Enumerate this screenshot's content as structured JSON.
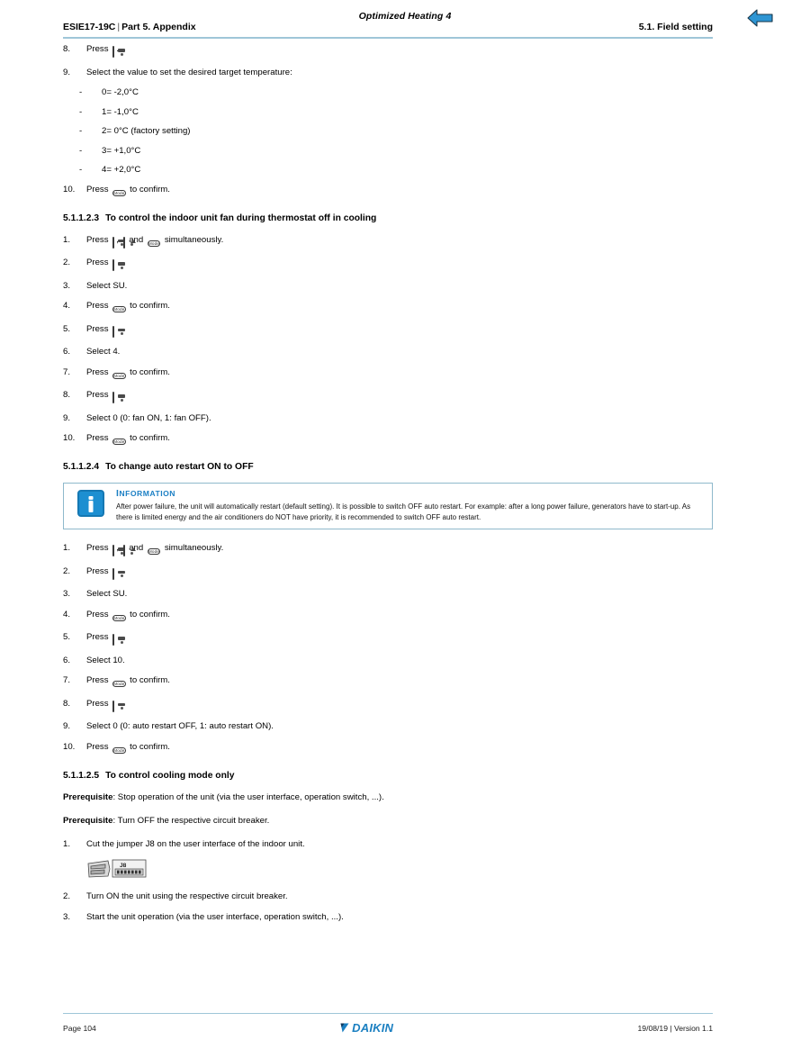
{
  "header": {
    "running_title": "Optimized Heating 4",
    "doc_code": "ESIE17-19C",
    "separator": "|",
    "part": "Part 5. Appendix",
    "section_right": "5.1. Field setting",
    "back_icon": "back-arrow-icon",
    "rule_color": "#9fc6d8"
  },
  "keys": {
    "temp_label": "Temp",
    "mode_label": "Mode",
    "timer_label": "Timer"
  },
  "top_steps": [
    {
      "num": "8.",
      "pre": "Press",
      "key": "temp",
      "post": "."
    },
    {
      "num": "9.",
      "pre": "Select the value to set the desired target temperature:",
      "key": "",
      "post": ""
    }
  ],
  "temperature_options": [
    {
      "dash": "-",
      "text": "0= -2,0°C"
    },
    {
      "dash": "-",
      "text": "1= -1,0°C"
    },
    {
      "dash": "-",
      "text": "2= 0°C (factory setting)"
    },
    {
      "dash": "-",
      "text": "3= +1,0°C"
    },
    {
      "dash": "-",
      "text": "4= +2,0°C"
    }
  ],
  "step10_top": {
    "num": "10.",
    "pre": "Press",
    "key": "mode",
    "post": "to confirm."
  },
  "section_fan": {
    "number": "5.1.1.2.3",
    "title": "To control the indoor unit fan during thermostat off in cooling",
    "steps": [
      {
        "num": "1.",
        "pre": "Press",
        "keys": "temp,timer,mode",
        "post": "simultaneously."
      },
      {
        "num": "2.",
        "pre": "Press",
        "keys": "temp",
        "post": "."
      },
      {
        "num": "3.",
        "pre": "Select SU.",
        "keys": "",
        "post": ""
      },
      {
        "num": "4.",
        "pre": "Press",
        "keys": "mode",
        "post": "to confirm."
      },
      {
        "num": "5.",
        "pre": "Press",
        "keys": "temp",
        "post": "."
      },
      {
        "num": "6.",
        "pre": "Select 4.",
        "keys": "",
        "post": ""
      },
      {
        "num": "7.",
        "pre": "Press",
        "keys": "mode",
        "post": "to confirm."
      },
      {
        "num": "8.",
        "pre": "Press",
        "keys": "temp",
        "post": "."
      },
      {
        "num": "9.",
        "pre": "Select 0 (0: fan ON, 1: fan OFF).",
        "keys": "",
        "post": ""
      },
      {
        "num": "10.",
        "pre": "Press",
        "keys": "mode",
        "post": "to confirm."
      }
    ]
  },
  "section_restart": {
    "number": "5.1.1.2.4",
    "title": "To change auto restart ON to OFF",
    "note": {
      "icon": "information-icon",
      "title": "INFORMATION",
      "title_first": "I",
      "title_rest": "NFORMATION",
      "text": "After power failure, the unit will automatically restart (default setting). It is possible to switch OFF auto restart. For example: after a long power failure, generators have to start-up. As there is limited energy and the air conditioners do NOT have priority, it is recommended to switch OFF auto restart.",
      "border_color": "#8fb9cc",
      "accent_color": "#1b7fc4"
    },
    "steps": [
      {
        "num": "1.",
        "pre": "Press",
        "keys": "temp,timer,mode",
        "post": "simultaneously."
      },
      {
        "num": "2.",
        "pre": "Press",
        "keys": "temp",
        "post": "."
      },
      {
        "num": "3.",
        "pre": "Select SU.",
        "keys": "",
        "post": ""
      },
      {
        "num": "4.",
        "pre": "Press",
        "keys": "mode",
        "post": "to confirm."
      },
      {
        "num": "5.",
        "pre": "Press",
        "keys": "temp",
        "post": "."
      },
      {
        "num": "6.",
        "pre": "Select 10.",
        "keys": "",
        "post": ""
      },
      {
        "num": "7.",
        "pre": "Press",
        "keys": "mode",
        "post": "to confirm."
      },
      {
        "num": "8.",
        "pre": "Press",
        "keys": "temp",
        "post": "."
      },
      {
        "num": "9.",
        "pre": "Select 0 (0: auto restart OFF, 1: auto restart ON).",
        "keys": "",
        "post": ""
      },
      {
        "num": "10.",
        "pre": "Press",
        "keys": "mode",
        "post": "to confirm."
      }
    ]
  },
  "section_cooling": {
    "number": "5.1.1.2.5",
    "title": "To control cooling mode only",
    "prerequisites": [
      {
        "label": "Prerequisite",
        "text": ": Stop operation of the unit (via the user interface, operation switch, ...)."
      },
      {
        "label": "Prerequisite",
        "text": ": Turn OFF the respective circuit breaker."
      }
    ],
    "steps": [
      {
        "num": "1.",
        "text": "Cut the jumper J8 on the user interface of the indoor unit."
      },
      {
        "num": "2.",
        "text": "Turn ON the unit using the respective circuit breaker."
      },
      {
        "num": "3.",
        "text": "Start the unit operation (via the user interface, operation switch, ...)."
      }
    ],
    "figure": {
      "name": "j8-jumper-diagram",
      "label": "J8"
    }
  },
  "footer": {
    "page": "Page 104",
    "brand": "DAIKIN",
    "brand_color": "#1a7fc1",
    "date": "19/08/19",
    "separator": "|",
    "version": "Version 1.1",
    "date_version": "19/08/19 | Version 1.1"
  }
}
